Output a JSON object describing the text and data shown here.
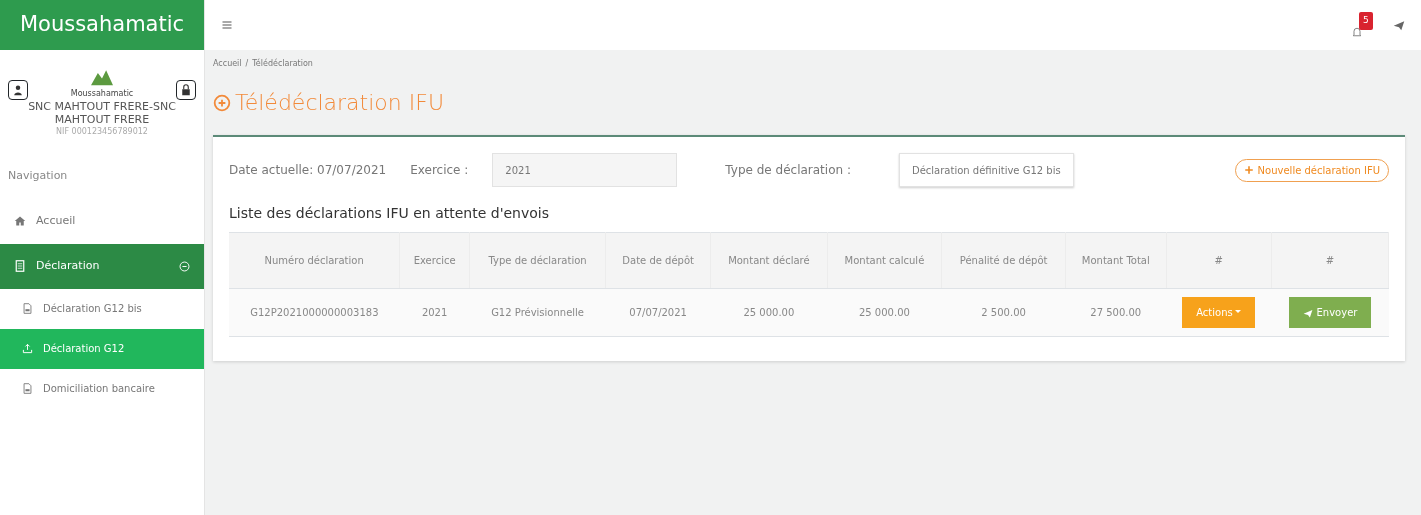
{
  "brand": "Moussahamatic",
  "topbar": {
    "notification_count": "5"
  },
  "profile": {
    "logo_text": "Moussahamatic",
    "company": "SNC MAHTOUT FRERE-SNC MAHTOUT FRERE",
    "nif": "NIF 000123456789012"
  },
  "sidebar": {
    "heading": "Navigation",
    "items": [
      {
        "label": "Accueil",
        "selected": false
      },
      {
        "label": "Déclaration",
        "selected": true,
        "expanded": true,
        "children": [
          {
            "label": "Déclaration G12 bis",
            "selected": false
          },
          {
            "label": "Déclaration G12",
            "selected": true
          },
          {
            "label": "Domiciliation bancaire",
            "selected": false
          }
        ]
      }
    ]
  },
  "breadcrumb": [
    "Accueil",
    "Télédéclaration"
  ],
  "breadcrumb_separator": "/",
  "page_title": "Télédéclaration IFU",
  "filters": {
    "date_label": "Date actuelle: 07/07/2021",
    "exercice_label": "Exercice :",
    "exercice_value": "2021",
    "type_label": "Type de déclaration :",
    "type_value": "Déclaration définitive G12 bis",
    "new_button": "Nouvelle déclaration IFU"
  },
  "list_title": "Liste des déclarations IFU en attente d'envois",
  "table": {
    "columns": [
      "Numéro déclaration",
      "Exercice",
      "Type de déclaration",
      "Date de dépôt",
      "Montant déclaré",
      "Montant calculé",
      "Pénalité de dépôt",
      "Montant Total",
      "#",
      "#"
    ],
    "rows": [
      {
        "cells": [
          "G12P2021000000003183",
          "2021",
          "G12 Prévisionnelle",
          "07/07/2021",
          "25 000.00",
          "25 000.00",
          "2 500.00",
          "27 500.00"
        ],
        "actions_button": "Actions",
        "send_button": "Envoyer"
      }
    ]
  }
}
